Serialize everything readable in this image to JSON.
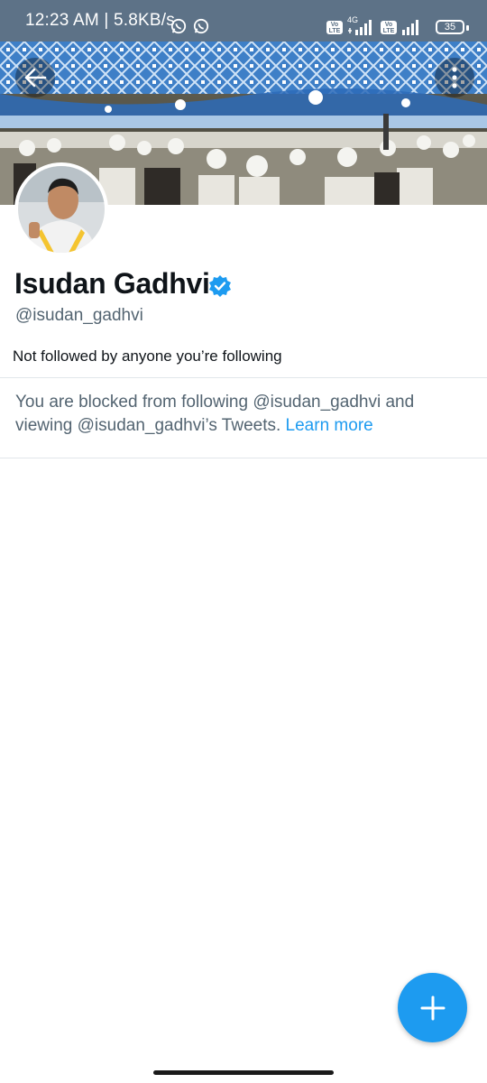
{
  "status_bar": {
    "time": "12:23 AM | 5.8KB/s",
    "network_type": "4G",
    "volte_label": "Vo LTE",
    "battery_level": "35",
    "icons": [
      "whatsapp-icon",
      "whatsapp-icon",
      "signal-icon",
      "signal-icon",
      "battery-icon"
    ]
  },
  "header": {
    "back_icon": "arrow-left-icon",
    "more_icon": "more-vertical-icon"
  },
  "profile": {
    "display_name": "Isudan Gadhvi",
    "verified": true,
    "handle": "@isudan_gadhvi",
    "followed_by_text": "Not followed by anyone you’re following"
  },
  "blocked_notice": {
    "text": "You are blocked from following @isudan_gadhvi and viewing @isudan_gadhvi’s Tweets.",
    "link_text": "Learn more"
  },
  "fab": {
    "icon": "plus-icon"
  },
  "colors": {
    "accent": "#1d9bf0",
    "status_bar": "#5d7287",
    "secondary_text": "#536471"
  }
}
